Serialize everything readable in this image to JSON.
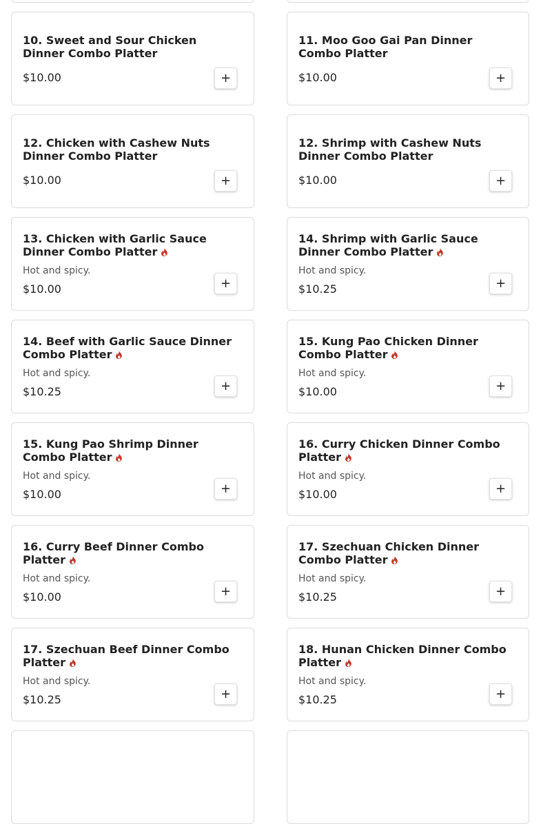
{
  "menu": {
    "add_button_label": "+",
    "spicy_icon": "flame-icon",
    "spicy_color": "#c0392b",
    "items": [
      {
        "title": "",
        "description": "",
        "price": "",
        "spicy": false,
        "partial": true
      },
      {
        "title": "",
        "description": "",
        "price": "",
        "spicy": false,
        "partial": true
      },
      {
        "title": "10. Sweet and Sour Chicken Dinner Combo Platter",
        "description": "",
        "price": "$10.00",
        "spicy": false
      },
      {
        "title": "11. Moo Goo Gai Pan Dinner Combo Platter",
        "description": "",
        "price": "$10.00",
        "spicy": false
      },
      {
        "title": "12. Chicken with Cashew Nuts Dinner Combo Platter",
        "description": "",
        "price": "$10.00",
        "spicy": false
      },
      {
        "title": "12. Shrimp with Cashew Nuts Dinner Combo Platter",
        "description": "",
        "price": "$10.00",
        "spicy": false
      },
      {
        "title": "13. Chicken with Garlic Sauce Dinner Combo Platter",
        "description": "Hot and spicy.",
        "price": "$10.00",
        "spicy": true
      },
      {
        "title": "14. Shrimp with Garlic Sauce Dinner Combo Platter",
        "description": "Hot and spicy.",
        "price": "$10.25",
        "spicy": true
      },
      {
        "title": "14. Beef with Garlic Sauce Dinner Combo Platter",
        "description": "Hot and spicy.",
        "price": "$10.25",
        "spicy": true
      },
      {
        "title": "15. Kung Pao Chicken Dinner Combo Platter",
        "description": "Hot and spicy.",
        "price": "$10.00",
        "spicy": true
      },
      {
        "title": "15. Kung Pao Shrimp Dinner Combo Platter",
        "description": "Hot and spicy.",
        "price": "$10.00",
        "spicy": true
      },
      {
        "title": "16. Curry Chicken Dinner Combo Platter",
        "description": "Hot and spicy.",
        "price": "$10.00",
        "spicy": true
      },
      {
        "title": "16. Curry Beef Dinner Combo Platter",
        "description": "Hot and spicy.",
        "price": "$10.00",
        "spicy": true
      },
      {
        "title": "17. Szechuan Chicken Dinner Combo Platter",
        "description": "Hot and spicy.",
        "price": "$10.25",
        "spicy": true
      },
      {
        "title": "17. Szechuan Beef Dinner Combo Platter",
        "description": "Hot and spicy.",
        "price": "$10.25",
        "spicy": true
      },
      {
        "title": "18. Hunan Chicken Dinner Combo Platter",
        "description": "Hot and spicy.",
        "price": "$10.25",
        "spicy": true
      },
      {
        "title": "",
        "description": "",
        "price": "",
        "spicy": false,
        "partial": true
      },
      {
        "title": "",
        "description": "",
        "price": "",
        "spicy": false,
        "partial": true
      }
    ]
  }
}
